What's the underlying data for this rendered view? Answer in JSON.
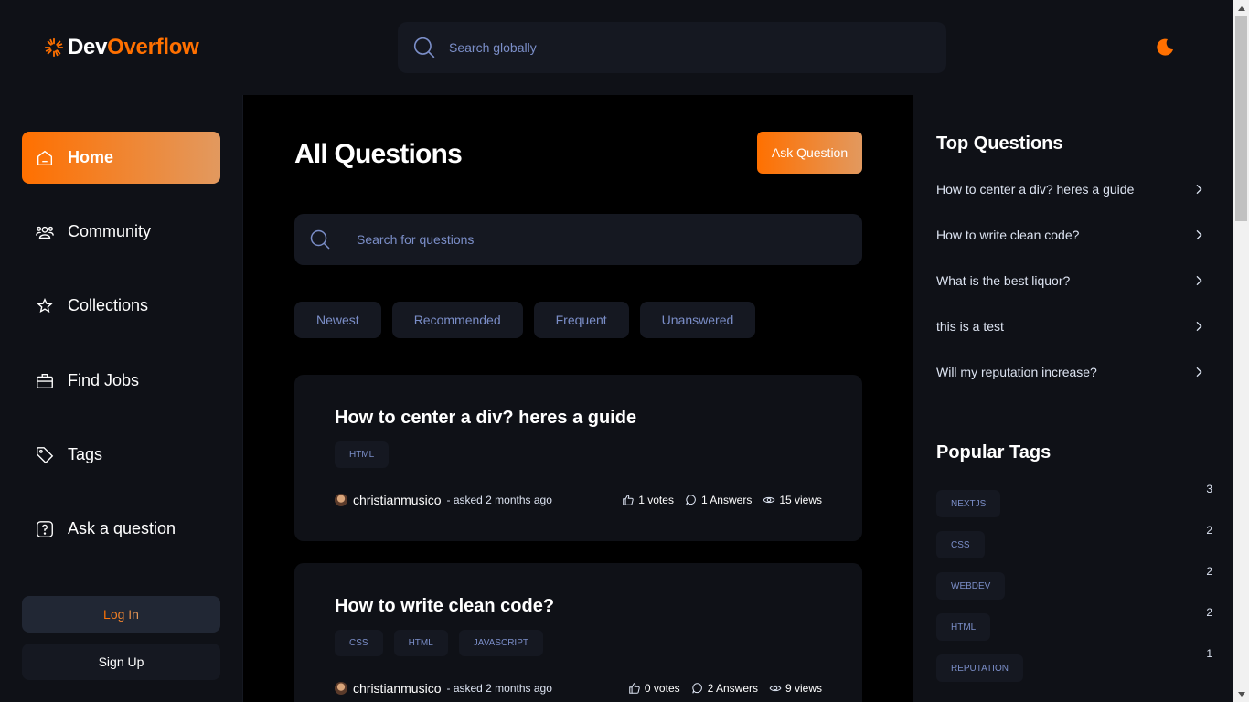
{
  "brand": {
    "part1": "Dev",
    "part2": "Overflow",
    "accent": "#ff7000"
  },
  "header": {
    "search_placeholder": "Search globally",
    "theme_icon": "moon-icon"
  },
  "sidebar": {
    "items": [
      {
        "label": "Home",
        "icon": "home-icon",
        "active": true
      },
      {
        "label": "Community",
        "icon": "users-icon"
      },
      {
        "label": "Collections",
        "icon": "star-icon"
      },
      {
        "label": "Find Jobs",
        "icon": "suitcase-icon"
      },
      {
        "label": "Tags",
        "icon": "tag-icon"
      },
      {
        "label": "Ask a question",
        "icon": "question-icon"
      }
    ],
    "login_label": "Log In",
    "signup_label": "Sign Up"
  },
  "main": {
    "title": "All Questions",
    "ask_button": "Ask Question",
    "search_placeholder": "Search for questions",
    "filters": [
      "Newest",
      "Recommended",
      "Frequent",
      "Unanswered"
    ],
    "questions": [
      {
        "title": "How to center a div? heres a guide",
        "tags": [
          "HTML"
        ],
        "author": "christianmusico",
        "asked": "- asked 2 months ago",
        "votes": "1 votes",
        "answers": "1 Answers",
        "views": "15 views"
      },
      {
        "title": "How to write clean code?",
        "tags": [
          "CSS",
          "HTML",
          "JAVASCRIPT"
        ],
        "author": "christianmusico",
        "asked": "- asked 2 months ago",
        "votes": "0 votes",
        "answers": "2 Answers",
        "views": "9 views"
      }
    ]
  },
  "right": {
    "top_title": "Top Questions",
    "top_questions": [
      "How to center a div? heres a guide",
      "How to write clean code?",
      "What is the best liquor?",
      "this is a test",
      "Will my reputation increase?"
    ],
    "tags_title": "Popular Tags",
    "popular_tags": [
      {
        "name": "NEXTJS",
        "count": "3"
      },
      {
        "name": "CSS",
        "count": "2"
      },
      {
        "name": "WEBDEV",
        "count": "2"
      },
      {
        "name": "HTML",
        "count": "2"
      },
      {
        "name": "REPUTATION",
        "count": "1"
      }
    ]
  }
}
